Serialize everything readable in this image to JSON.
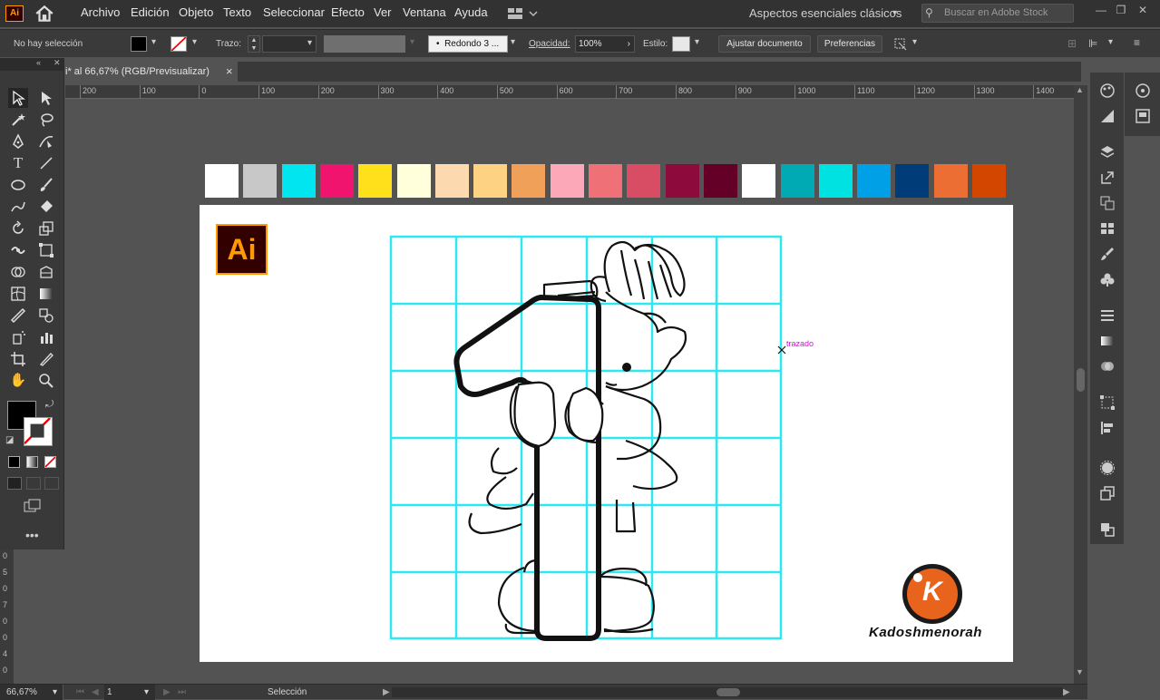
{
  "app": {
    "logo": "Ai"
  },
  "menu": [
    "Archivo",
    "Edición",
    "Objeto",
    "Texto",
    "Seleccionar",
    "Efecto",
    "Ver",
    "Ventana",
    "Ayuda"
  ],
  "workspace": "Aspectos esenciales clásicos",
  "search_placeholder": "Buscar en Adobe Stock",
  "control": {
    "selection": "No hay selección",
    "stroke_label": "Trazo:",
    "brush": "Redondo 3 ...",
    "opacity_label": "Opacidad:",
    "opacity_value": "100%",
    "style_label": "Estilo:",
    "fit_button": "Ajustar documento",
    "prefs_button": "Preferencias"
  },
  "document": {
    "tab_title": "i* al 66,67% (RGB/Previsualizar)",
    "close": "×"
  },
  "ruler": {
    "ticks": [
      "200",
      "100",
      "0",
      "100",
      "200",
      "300",
      "400",
      "500",
      "600",
      "700",
      "800",
      "900",
      "1000",
      "1100",
      "1200",
      "1300",
      "1400"
    ]
  },
  "vruler": [
    "0",
    "5",
    "0",
    "7",
    "0",
    "0",
    "4",
    "0"
  ],
  "canvas": {
    "hint_label": "trazado",
    "logo_text": "Ai",
    "brand_letter": "K",
    "brand_name": "Kadoshmenorah"
  },
  "swatches": [
    "#ffffff",
    "#c8c8c8",
    "#00e5f0",
    "#f0146e",
    "#ffe01a",
    "#ffffdc",
    "#fdd9b0",
    "#fdd282",
    "#f0a058",
    "#fca8b8",
    "#f07078",
    "#d84c64",
    "#8c0a3c",
    "#640028",
    "#ffffff",
    "#00aab4",
    "#00e1e1",
    "#00a0e6",
    "#003c78",
    "#ec6e32",
    "#d24600"
  ],
  "status": {
    "zoom": "66,67%",
    "page": "1",
    "mode": "Selección"
  },
  "colors": {
    "grid": "#2ee8f0",
    "accent": "#ff9a00",
    "hint": "#e600e6"
  }
}
